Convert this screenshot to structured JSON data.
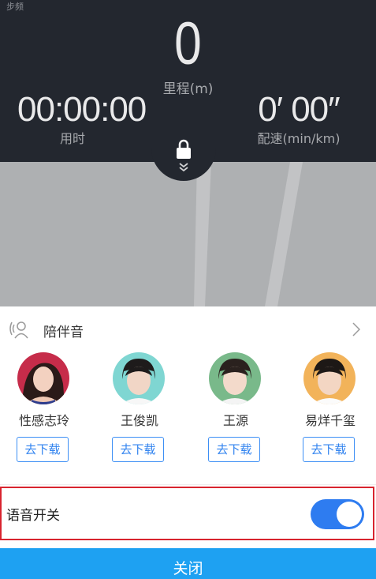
{
  "stats": {
    "status_glyph": "步频",
    "distance": "0",
    "distance_label": "里程(m)",
    "time": "00:00:00",
    "time_label": "用时",
    "pace": "0′ 00″",
    "pace_label": "配速(min/km)"
  },
  "companion": {
    "title": "陪伴音",
    "packs": [
      {
        "name": "性感志玲",
        "download_label": "去下载"
      },
      {
        "name": "王俊凯",
        "download_label": "去下载"
      },
      {
        "name": "王源",
        "download_label": "去下载"
      },
      {
        "name": "易烊千玺",
        "download_label": "去下载"
      }
    ]
  },
  "voice_switch": {
    "label": "语音开关",
    "on": true
  },
  "close_label": "关闭",
  "colors": {
    "accent": "#2e7cf0",
    "panel": "#23272f",
    "close_bar": "#1ea1f2",
    "highlight_border": "#d8242f"
  },
  "icons": [
    "lock-icon",
    "double-chevron-icon",
    "voice-icon",
    "chevron-right-icon"
  ]
}
